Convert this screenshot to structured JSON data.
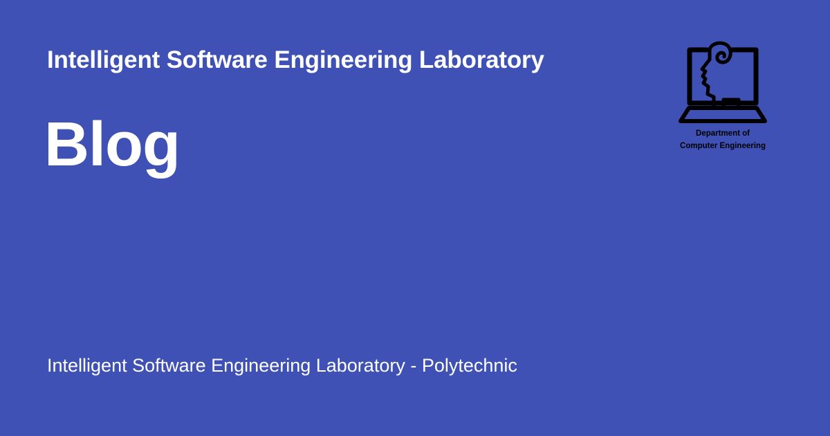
{
  "header": {
    "site_title": "Intelligent Software Engineering Laboratory"
  },
  "main": {
    "page_title": "Blog"
  },
  "footer": {
    "text": "Intelligent Software Engineering Laboratory - Polytechnic"
  },
  "logo": {
    "icon": "computer-head-logo",
    "line1": "Department of",
    "line2": "Computer Engineering"
  },
  "colors": {
    "background": "#3f51b5",
    "text": "#ffffff",
    "logo": "#000000"
  }
}
